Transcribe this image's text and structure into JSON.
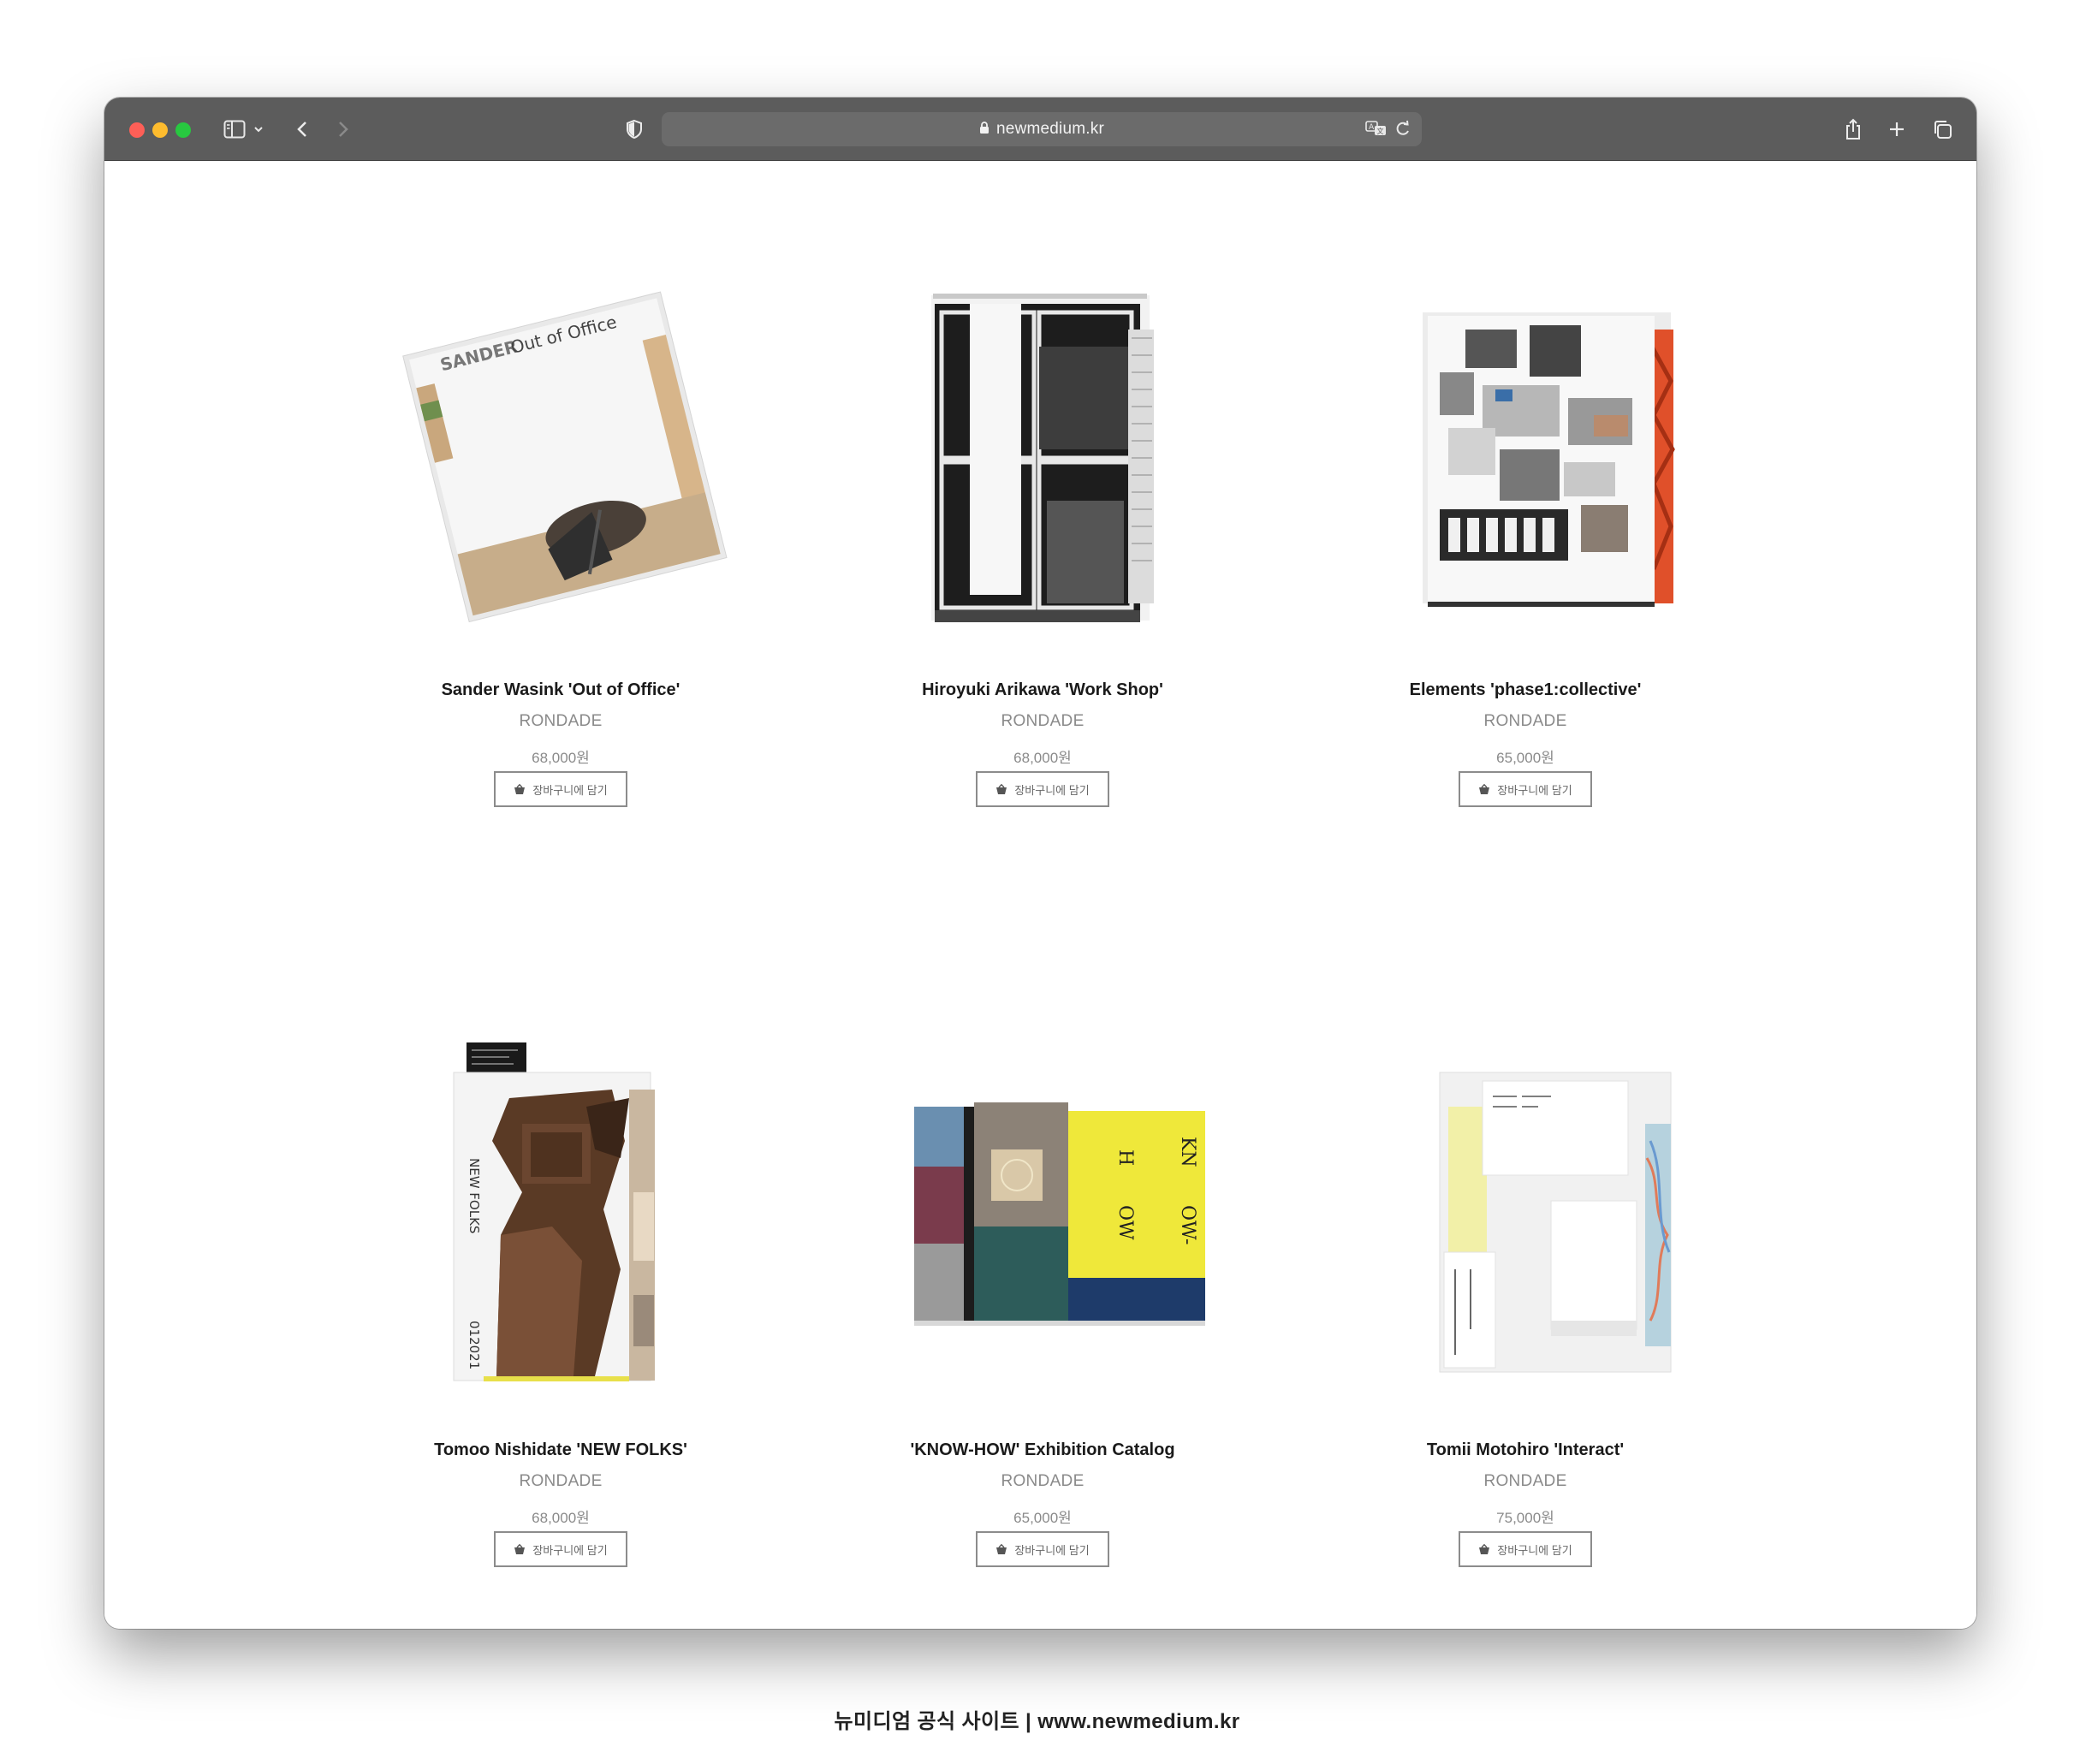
{
  "browser": {
    "url": "newmedium.kr",
    "colors": {
      "toolbar": "#5c5c5c",
      "red": "#fe5f57",
      "yellow": "#febc2e",
      "green": "#28c840"
    }
  },
  "products": [
    {
      "name": "Sander Wasink 'Out of Office'",
      "brand": "RONDADE",
      "price": "68,000원",
      "cart_label": "장바구니에 담기"
    },
    {
      "name": "Hiroyuki Arikawa 'Work Shop'",
      "brand": "RONDADE",
      "price": "68,000원",
      "cart_label": "장바구니에 담기"
    },
    {
      "name": "Elements 'phase1:collective'",
      "brand": "RONDADE",
      "price": "65,000원",
      "cart_label": "장바구니에 담기"
    },
    {
      "name": "Tomoo Nishidate 'NEW FOLKS'",
      "brand": "RONDADE",
      "price": "68,000원",
      "cart_label": "장바구니에 담기"
    },
    {
      "name": "'KNOW-HOW' Exhibition Catalog",
      "brand": "RONDADE",
      "price": "65,000원",
      "cart_label": "장바구니에 담기"
    },
    {
      "name": "Tomii Motohiro 'Interact'",
      "brand": "RONDADE",
      "price": "75,000원",
      "cart_label": "장바구니에 담기"
    }
  ],
  "caption": "뉴미디엄 공식 사이트  |  www.newmedium.kr"
}
